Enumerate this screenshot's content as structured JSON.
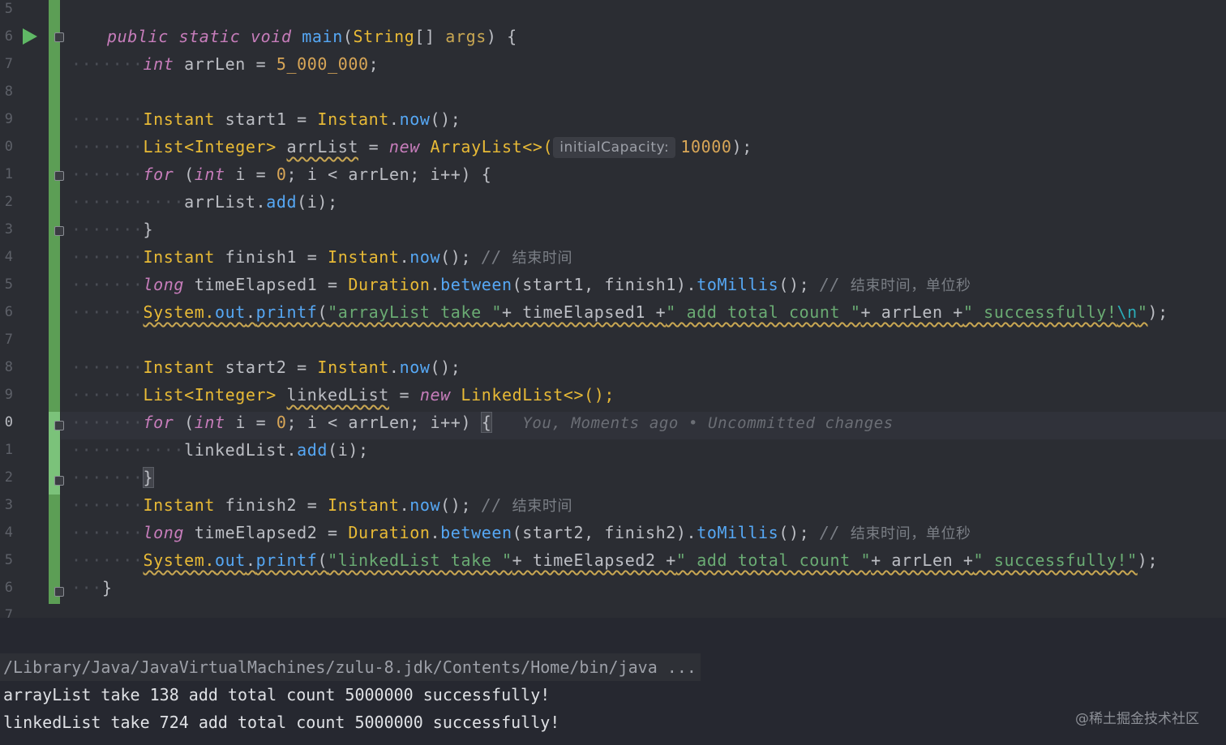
{
  "editor": {
    "line_numbers": [
      "5",
      "6",
      "7",
      "8",
      "9",
      "0",
      "1",
      "2",
      "3",
      "4",
      "5",
      "6",
      "7",
      "8",
      "9",
      "0",
      "1",
      "2",
      "3",
      "4",
      "5",
      "6",
      "7"
    ],
    "lines": {
      "l26": {
        "kw1": "public",
        "kw2": "static",
        "kw3": "void",
        "name": "main",
        "p1": "(",
        "type": "String",
        "p2": "[] ",
        "arg": "args",
        "p3": ") {"
      },
      "l27": {
        "kw": "int",
        "rest": " arrLen = ",
        "num": "5_000_000",
        "end": ";"
      },
      "l29": {
        "cls1": "Instant",
        "mid": " start1 = ",
        "cls2": "Instant",
        "dot": ".",
        "fn": "now",
        "end": "();"
      },
      "l30": {
        "t1": "List<Integer> ",
        "var": "arrList",
        "t2": " = ",
        "kw": "new",
        "t3": " ArrayList<>(",
        "hint": "initialCapacity:",
        "num": "10000",
        "end": ");"
      },
      "l31": {
        "kw": "for",
        "t1": " (",
        "kw2": "int",
        "t2": " i = ",
        "num": "0",
        "t3": "; i < arrLen; i++) {"
      },
      "l32": {
        "obj": "arrList.",
        "fn": "add",
        "end": "(i);"
      },
      "l33": {
        "text": "}"
      },
      "l34": {
        "cls1": "Instant",
        "mid": " finish1 = ",
        "cls2": "Instant",
        "dot": ".",
        "fn": "now",
        "end": "(); ",
        "cmt": "// ",
        "cjk": "结束时间"
      },
      "l35": {
        "kw": "long",
        "mid": " timeElapsed1 = ",
        "cls": "Duration",
        "dot": ".",
        "fn1": "between",
        "args": "(start1, finish1).",
        "fn2": "toMillis",
        "end": "(); ",
        "cmt": "// ",
        "cjk": "结束时间，单位秒"
      },
      "l36": {
        "sys": "System.",
        "out": "out",
        "dot": ".",
        "fn": "printf",
        "p1": "(",
        "s1": "\"arrayList take \"",
        "m1": "+ timeElapsed1 +",
        "s2": "\" add total count \"",
        "m2": "+ arrLen +",
        "s3": "\" successfully!",
        "esc": "\\n",
        "s4": "\"",
        "end": ");"
      },
      "l38": {
        "cls1": "Instant",
        "mid": " start2 = ",
        "cls2": "Instant",
        "dot": ".",
        "fn": "now",
        "end": "();"
      },
      "l39": {
        "t1": "List<Integer> ",
        "var": "linkedList",
        "t2": " = ",
        "kw": "new",
        "t3": " LinkedList<>();"
      },
      "l40": {
        "kw": "for",
        "t1": " (",
        "kw2": "int",
        "t2": " i = ",
        "num": "0",
        "t3": "; i < arrLen; i++) ",
        "brace": "{",
        "blame": "You, Moments ago • Uncommitted changes"
      },
      "l41": {
        "obj": "linkedList.",
        "fn": "add",
        "end": "(i);"
      },
      "l42": {
        "text": "}"
      },
      "l43": {
        "cls1": "Instant",
        "mid": " finish2 = ",
        "cls2": "Instant",
        "dot": ".",
        "fn": "now",
        "end": "(); ",
        "cmt": "// ",
        "cjk": "结束时间"
      },
      "l44": {
        "kw": "long",
        "mid": " timeElapsed2 = ",
        "cls": "Duration",
        "dot": ".",
        "fn1": "between",
        "args": "(start2, finish2).",
        "fn2": "toMillis",
        "end": "(); ",
        "cmt": "// ",
        "cjk": "结束时间，单位秒"
      },
      "l45": {
        "sys": "System.",
        "out": "out",
        "dot": ".",
        "fn": "printf",
        "p1": "(",
        "s1": "\"linkedList take \"",
        "m1": "+ timeElapsed2 +",
        "s2": "\" add total count \"",
        "m2": "+ arrLen +",
        "s3": "\" successfully!\"",
        "end": ");"
      },
      "l46": {
        "text": "}"
      }
    }
  },
  "console": {
    "command": "/Library/Java/JavaVirtualMachines/zulu-8.jdk/Contents/Home/bin/java ...",
    "out1": "arrayList take 138 add total count 5000000 successfully!",
    "out2": "linkedList take 724 add total count 5000000 successfully!"
  },
  "watermark": "@稀土掘金技术社区",
  "colors": {
    "vcs_added": "#5c9e55",
    "run_icon": "#5fb865",
    "background": "#2b2d33"
  }
}
